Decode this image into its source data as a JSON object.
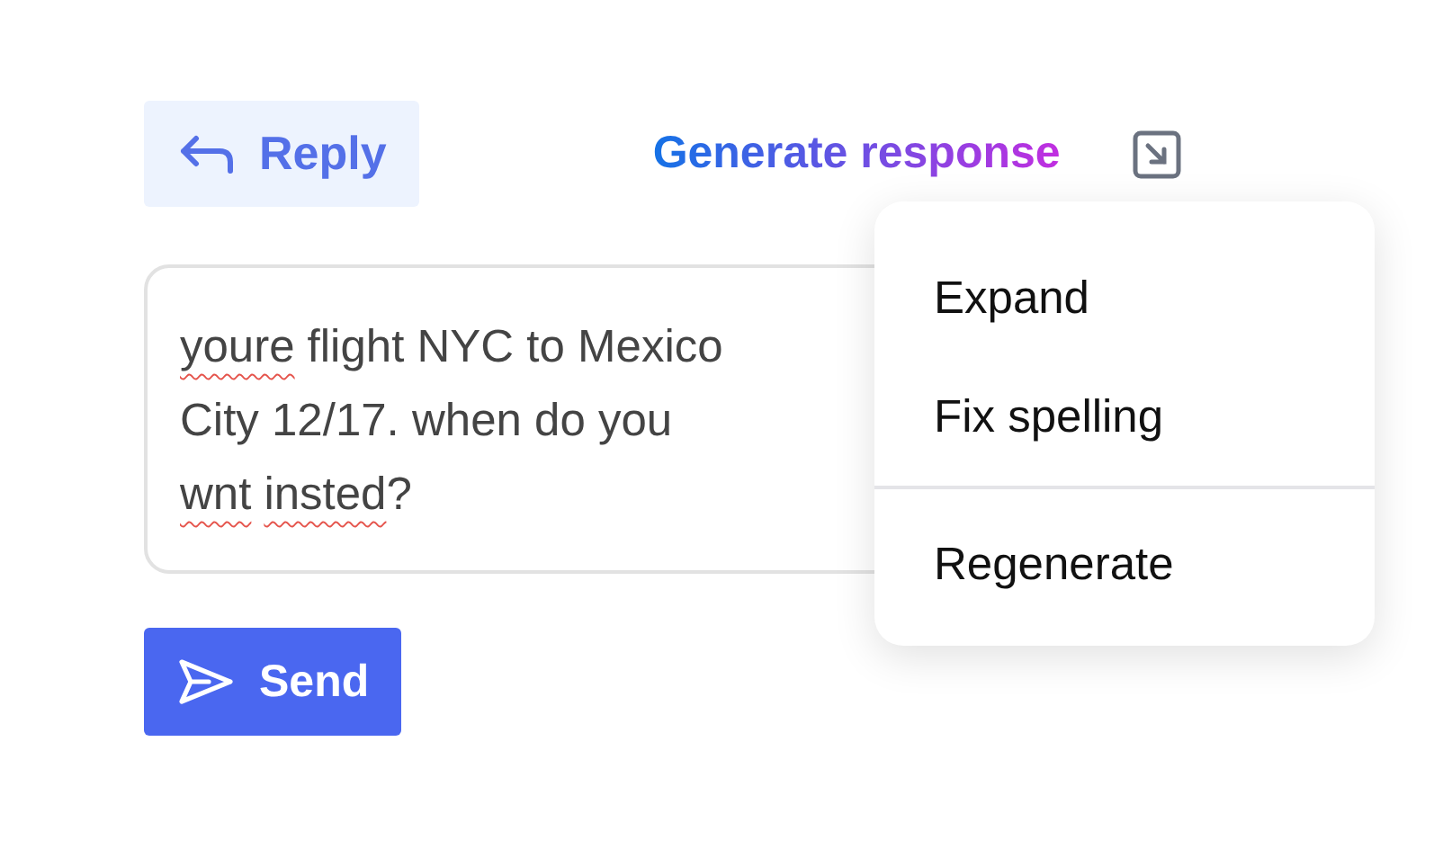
{
  "reply_button": {
    "label": "Reply"
  },
  "generate_link": {
    "label": "Generate response"
  },
  "message": {
    "lines": [
      [
        {
          "text": "youre",
          "misspelled": true
        },
        {
          "text": "flight NYC to Mexico",
          "misspelled": false
        }
      ],
      [
        {
          "text": "City 12/17. when do you",
          "misspelled": false
        }
      ],
      [
        {
          "text": "wnt",
          "misspelled": true
        },
        {
          "text": "insted",
          "misspelled": true
        },
        {
          "text": "?",
          "misspelled": false
        }
      ]
    ]
  },
  "send_button": {
    "label": "Send"
  },
  "menu": {
    "items": [
      {
        "label": "Expand",
        "divider_before": false
      },
      {
        "label": "Fix spelling",
        "divider_before": false
      },
      {
        "label": "Regenerate",
        "divider_before": true
      }
    ]
  }
}
